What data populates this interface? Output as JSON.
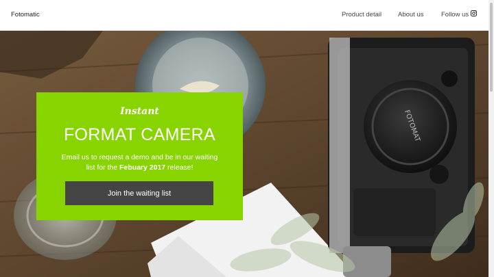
{
  "nav": {
    "brand": "Fotomatic",
    "links": [
      "Product detail",
      "About us",
      "Follow us"
    ],
    "social_icon": "instagram-icon"
  },
  "hero": {
    "script_title": "Instant",
    "title": "FORMAT CAMERA",
    "text_before": "Email us to request a demo and be in our waiting list for the ",
    "text_bold": "Febuary 2017",
    "text_after": " release!",
    "cta_label": "Join the waiting list",
    "camera_badge": "FOTOMAT"
  },
  "colors": {
    "accent": "#88d400",
    "button": "#454545",
    "wood": "#7a5a3e"
  }
}
